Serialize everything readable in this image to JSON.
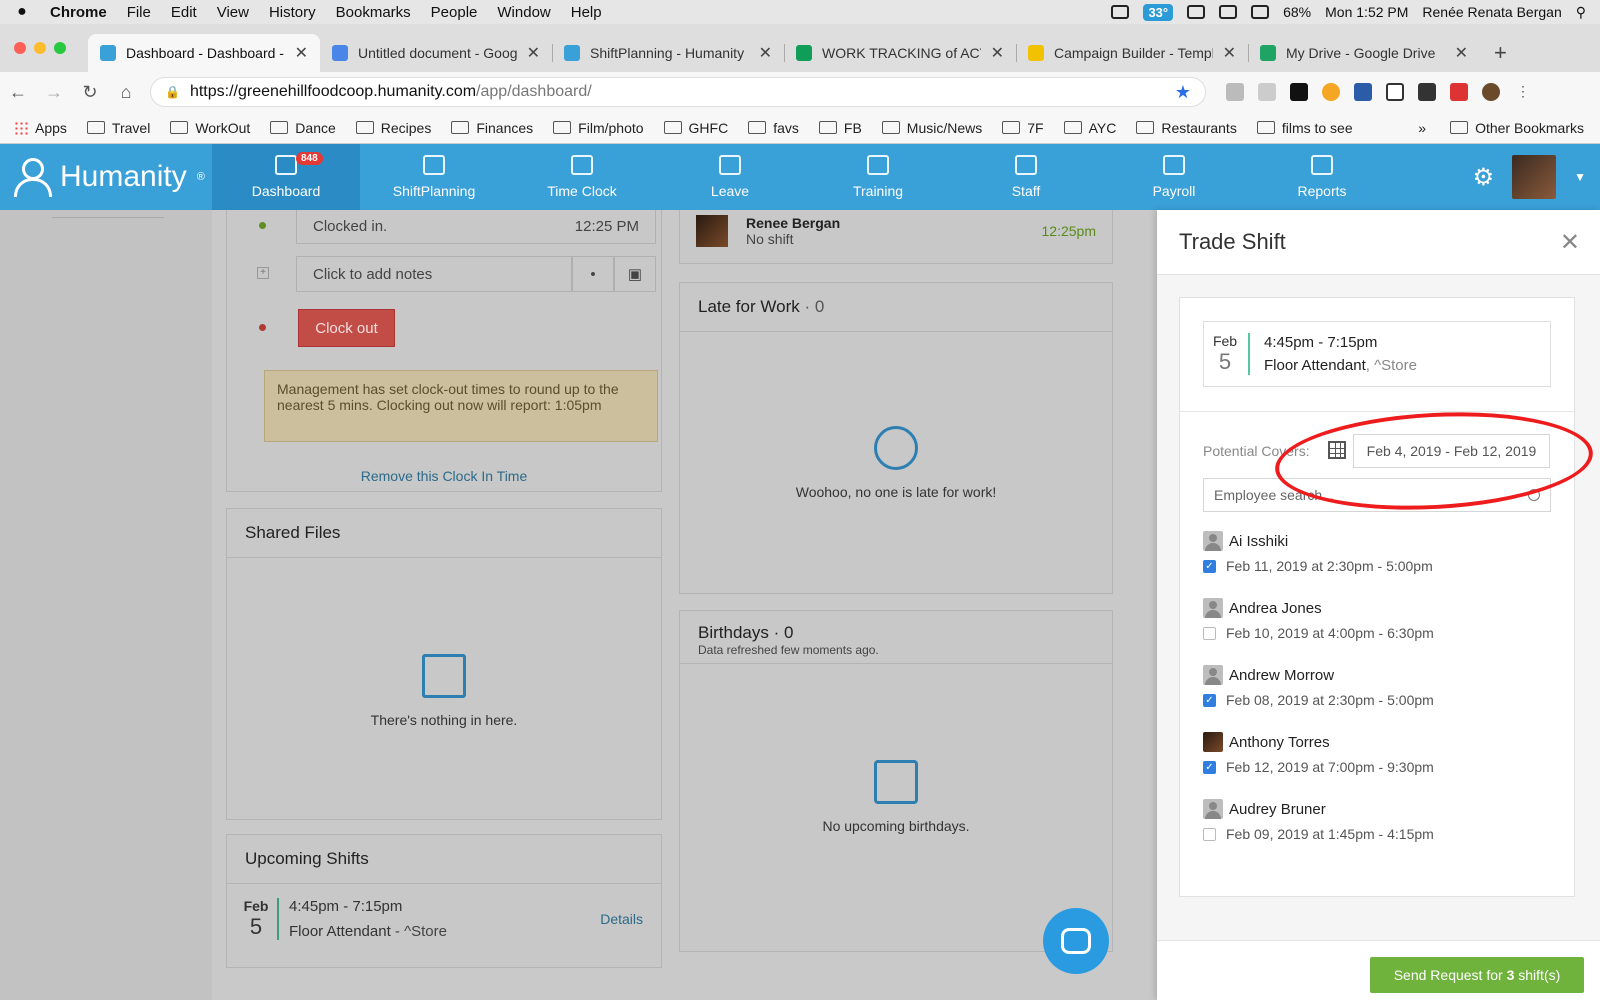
{
  "menubar": {
    "app": "Chrome",
    "items": [
      "File",
      "Edit",
      "View",
      "History",
      "Bookmarks",
      "People",
      "Window",
      "Help"
    ],
    "weather": "33°",
    "battery": "68%",
    "clock": "Mon 1:52 PM",
    "user": "Renée Renata Bergan"
  },
  "tabs": [
    {
      "title": "Dashboard - Dashboard -",
      "color": "#3aa0d8"
    },
    {
      "title": "Untitled document - Goog",
      "color": "#4a86e8"
    },
    {
      "title": "ShiftPlanning - Humanity",
      "color": "#3aa0d8"
    },
    {
      "title": "WORK TRACKING of ACTI",
      "color": "#0f9d58"
    },
    {
      "title": "Campaign Builder - Templ",
      "color": "#f2c200"
    },
    {
      "title": "My Drive - Google Drive",
      "color": "#1fa463"
    }
  ],
  "url": {
    "host": "https://greenehillfoodcoop.humanity.com",
    "path": "/app/dashboard/"
  },
  "bookmarks": [
    "Apps",
    "Travel",
    "WorkOut",
    "Dance",
    "Recipes",
    "Finances",
    "Film/photo",
    "GHFC",
    "favs",
    "FB",
    "Music/News",
    "7F",
    "AYC",
    "Restaurants",
    "films to see"
  ],
  "other_bookmarks": "Other Bookmarks",
  "app": {
    "logo": "Humanity",
    "nav": [
      {
        "label": "Dashboard",
        "badge": "848"
      },
      {
        "label": "ShiftPlanning"
      },
      {
        "label": "Time Clock"
      },
      {
        "label": "Leave"
      },
      {
        "label": "Training"
      },
      {
        "label": "Staff"
      },
      {
        "label": "Payroll"
      },
      {
        "label": "Reports"
      }
    ]
  },
  "clock": {
    "clocked_in": "Clocked in.",
    "clocked_time": "12:25 PM",
    "notes_placeholder": "Click to add notes",
    "clock_out": "Clock out",
    "notice": "Management has set clock-out times to round up to the nearest 5 mins. Clocking out now will report: 1:05pm",
    "remove_link": "Remove this Clock In Time"
  },
  "shared_files": {
    "title": "Shared Files",
    "empty": "There's nothing in here."
  },
  "upcoming": {
    "title": "Upcoming Shifts",
    "month": "Feb",
    "day": "5",
    "time": "4:45pm - 7:15pm",
    "role": "Floor Attendant",
    "location": " - ^Store",
    "details": "Details"
  },
  "on_now": {
    "name": "Renee Bergan",
    "status": "No shift",
    "time": "12:25pm"
  },
  "late": {
    "title": "Late for Work",
    "count": " · 0",
    "empty": "Woohoo, no one is late for work!"
  },
  "birthdays": {
    "title": "Birthdays",
    "count": " · 0",
    "refreshed": "Data refreshed few moments ago.",
    "empty": "No upcoming birthdays."
  },
  "trade": {
    "title": "Trade Shift",
    "shift": {
      "month": "Feb",
      "day": "5",
      "time": "4:45pm - 7:15pm",
      "role": "Floor Attendant",
      "location": ", ^Store"
    },
    "covers_label": "Potential Covers:",
    "date_range": "Feb 4, 2019 - Feb 12, 2019",
    "search_placeholder": "Employee search...",
    "covers": [
      {
        "name": "Ai Isshiki",
        "shift": "Feb 11, 2019 at 2:30pm - 5:00pm",
        "checked": true
      },
      {
        "name": "Andrea Jones",
        "shift": "Feb 10, 2019 at 4:00pm - 6:30pm",
        "checked": false
      },
      {
        "name": "Andrew Morrow",
        "shift": "Feb 08, 2019 at 2:30pm - 5:00pm",
        "checked": true
      },
      {
        "name": "Anthony Torres",
        "shift": "Feb 12, 2019 at 7:00pm - 9:30pm",
        "checked": true,
        "photo": true
      },
      {
        "name": "Audrey Bruner",
        "shift": "Feb 09, 2019 at 1:45pm - 4:15pm",
        "checked": false
      }
    ],
    "send_prefix": "Send Request for ",
    "send_count": "3",
    "send_suffix": " shift(s)"
  }
}
